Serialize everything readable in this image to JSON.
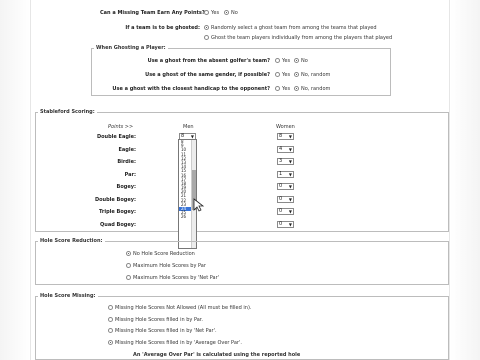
{
  "ghost": {
    "missing_team": {
      "label": "Can a Missing Team Earn Any Points?",
      "options": [
        "Yes",
        "No"
      ],
      "selected": 1
    },
    "team_ghosted": {
      "label": "If a team is to be ghosted:",
      "options": [
        "Randomly select a ghost team from among the teams that played",
        "Ghost the team players individually from among the players that played"
      ],
      "selected": 0
    }
  },
  "ghosting_player": {
    "legend": "When Ghosting a Player:",
    "rows": [
      {
        "label": "Use a ghost from the absent golfer's team?",
        "options": [
          "Yes",
          "No"
        ],
        "selected": 1
      },
      {
        "label": "Use a ghost of the same gender, if possible?",
        "options": [
          "Yes",
          "No, random"
        ],
        "selected": 1
      },
      {
        "label": "Use a ghost with the closest handicap to the opponent?",
        "options": [
          "Yes",
          "No, random"
        ],
        "selected": 1
      }
    ]
  },
  "stableford": {
    "legend": "Stableford Scoring:",
    "points_header": "Points >>",
    "men_header": "Men",
    "women_header": "Women",
    "rows": [
      {
        "label": "Double Eagle:",
        "men": "8",
        "women": "8"
      },
      {
        "label": "Eagle:",
        "men": "",
        "women": "4"
      },
      {
        "label": "Birdie:",
        "men": "",
        "women": "3"
      },
      {
        "label": "Par:",
        "men": "",
        "women": "1"
      },
      {
        "label": "Bogey:",
        "men": "",
        "women": "0"
      },
      {
        "label": "Double Bogey:",
        "men": "",
        "women": "0"
      },
      {
        "label": "Triple Bogey:",
        "men": "",
        "women": "0"
      },
      {
        "label": "Quad Bogey:",
        "men": "",
        "women": "0"
      }
    ],
    "dropdown_options": [
      "8",
      "9",
      "10",
      "11",
      "12",
      "13",
      "14",
      "15",
      "16",
      "17",
      "18",
      "19",
      "20",
      "21",
      "22",
      "23",
      "24",
      "25",
      "26"
    ],
    "dropdown_highlight": "24"
  },
  "hole_reduction": {
    "legend": "Hole Score Reduction:",
    "options": [
      "No Hole Score Reduction",
      "Maximum Hole Scores by Par",
      "Maximum Hole Scores by 'Net Par'"
    ],
    "selected": 0
  },
  "hole_missing": {
    "legend": "Hole Score Missing:",
    "options": [
      "Missing Hole Scores Not Allowed (All must be filled in).",
      "Missing Hole Scores filled in by Par.",
      "Missing Hole Scores filled in by 'Net Par'.",
      "Missing Hole Scores filled in by 'Average Over Par'."
    ],
    "selected": 3,
    "note": "An 'Average Over Par' is calculated using the reported hole"
  },
  "colors": {
    "highlight": "#3874d8",
    "border": "#bcbcbc"
  }
}
